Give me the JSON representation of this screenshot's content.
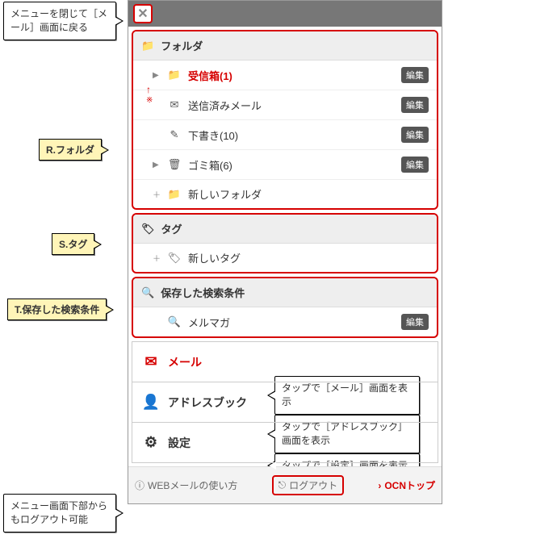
{
  "callouts": {
    "close": "メニューを閉じて［メール］画面に戻る",
    "folder_label": "R.フォルダ",
    "tag_label": "S.タグ",
    "search_label": "T.保存した検索条件",
    "mail_tip": "タップで［メール］画面を表示",
    "address_tip": "タップで［アドレスブック］画面を表示",
    "settings_tip": "タップで［設定］画面を表示",
    "logout_tip": "メニュー画面下部からもログアウト可能",
    "asterisk": "※"
  },
  "folders": {
    "header": "フォルダ",
    "items": [
      {
        "label": "受信箱(1)",
        "expandable": true,
        "active": true,
        "edit": "編集"
      },
      {
        "label": "送信済みメール",
        "expandable": false,
        "edit": "編集"
      },
      {
        "label": "下書き(10)",
        "expandable": false,
        "edit": "編集"
      },
      {
        "label": "ゴミ箱(6)",
        "expandable": true,
        "edit": "編集"
      }
    ],
    "new_label": "新しいフォルダ"
  },
  "tags": {
    "header": "タグ",
    "new_label": "新しいタグ"
  },
  "searches": {
    "header": "保存した検索条件",
    "items": [
      {
        "label": "メルマガ",
        "edit": "編集"
      }
    ]
  },
  "nav": {
    "mail": "メール",
    "address": "アドレスブック",
    "settings": "設定"
  },
  "footer": {
    "help": "WEBメールの使い方",
    "logout": "ログアウト",
    "ocn": "OCNトップ"
  }
}
